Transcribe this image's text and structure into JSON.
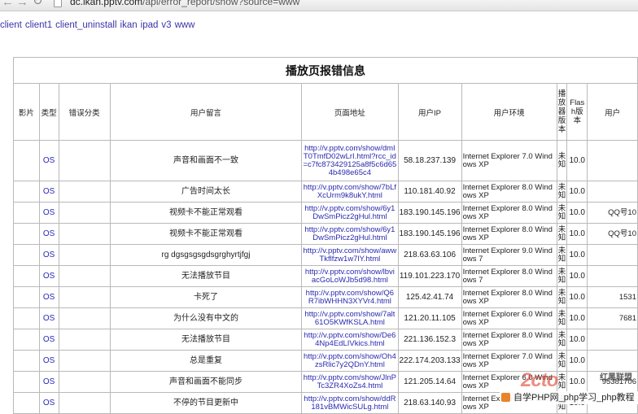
{
  "browser": {
    "url_host": "dc.ikan.pptv.com",
    "url_path": "/api/error_report/show?source=www"
  },
  "links": [
    "client",
    "client1",
    "client_uninstall",
    "ikan",
    "ipad",
    "v3",
    "www"
  ],
  "report": {
    "title": "播放页报错信息",
    "columns": [
      "影片",
      "类型",
      "错误分类",
      "用户留言",
      "页面地址",
      "用户IP",
      "用户环境",
      "播放器版本",
      "Flash版本",
      "用户"
    ],
    "rows": [
      {
        "type": "OS",
        "message": "声音和画面不一致",
        "url": "http://v.pptv.com/show/dmIT0TmfD02wLrI.html?rcc_id=c7fc873429125a8f5c6d654b498e65c4",
        "ip": "58.18.237.139",
        "env": "Internet Explorer 7.0 Windows XP",
        "player": "未知",
        "flash": "10.0",
        "extra": ""
      },
      {
        "type": "OS",
        "message": "广告时间太长",
        "url": "http://v.pptv.com/show/7bLfXcUrm9k8ukY.html",
        "ip": "110.181.40.92",
        "env": "Internet Explorer 8.0 Windows XP",
        "player": "未知",
        "flash": "10.0",
        "extra": ""
      },
      {
        "type": "OS",
        "message": "视频卡不能正常观看",
        "url": "http://v.pptv.com/show/6y1DwSmPicz2gHul.html",
        "ip": "183.190.145.196",
        "env": "Internet Explorer 8.0 Windows XP",
        "player": "未知",
        "flash": "10.0",
        "extra": "QQ号10"
      },
      {
        "type": "OS",
        "message": "视频卡不能正常观看",
        "url": "http://v.pptv.com/show/6y1DwSmPicz2gHul.html",
        "ip": "183.190.145.196",
        "env": "Internet Explorer 8.0 Windows XP",
        "player": "未知",
        "flash": "10.0",
        "extra": "QQ号10"
      },
      {
        "type": "OS",
        "message": "rg dgsgsgsgdsgrghyrtjfgj",
        "url": "http://v.pptv.com/show/awwTkflfzw1w7lY.html",
        "ip": "218.63.63.106",
        "env": "Internet Explorer 9.0 Windows 7",
        "player": "未知",
        "flash": "10.0",
        "extra": ""
      },
      {
        "type": "OS",
        "message": "无法播放节目",
        "url": "http://v.pptv.com/show/lbviacGoLoWJb5d98.html",
        "ip": "119.101.223.170",
        "env": "Internet Explorer 8.0 Windows 7",
        "player": "未知",
        "flash": "10.0",
        "extra": ""
      },
      {
        "type": "OS",
        "message": "卡死了",
        "url": "http://v.pptv.com/show/Q6R7ibWHHN3XYVr4.html",
        "ip": "125.42.41.74",
        "env": "Internet Explorer 8.0 Windows XP",
        "player": "未知",
        "flash": "10.0",
        "extra": "1531"
      },
      {
        "type": "OS",
        "message": "为什么没有中文的",
        "url": "http://v.pptv.com/show/7alt61O5KWfKSLA.html",
        "ip": "121.20.11.105",
        "env": "Internet Explorer 6.0 Windows XP",
        "player": "未知",
        "flash": "10.0",
        "extra": "7681"
      },
      {
        "type": "OS",
        "message": "无法播放节目",
        "url": "http://v.pptv.com/show/De64Np4EdLIVkics.html",
        "ip": "221.136.152.3",
        "env": "Internet Explorer 8.0 Windows XP",
        "player": "未知",
        "flash": "10.0",
        "extra": ""
      },
      {
        "type": "OS",
        "message": "总是重复",
        "url": "http://v.pptv.com/show/Oh4zsRlic7y2QDnY.html",
        "ip": "222.174.203.133",
        "env": "Internet Explorer 7.0 Windows XP",
        "player": "未知",
        "flash": "10.0",
        "extra": ""
      },
      {
        "type": "OS",
        "message": "声音和画面不能同步",
        "url": "http://v.pptv.com/show/JlnPTc3ZR4XoZs4.html",
        "ip": "121.205.14.64",
        "env": "Internet Explorer 6.0 Windows XP",
        "player": "未知",
        "flash": "10.0",
        "extra": "95381706"
      },
      {
        "type": "OS",
        "message": "不停的节目更新中",
        "url": "http://v.pptv.com/show/ddR181vBMWicSULg.html",
        "ip": "218.63.140.93",
        "env": "Internet Explorer 8.0 Windows XP",
        "player": "未知",
        "flash": "10.0",
        "extra": ""
      }
    ]
  },
  "watermark": {
    "logo": "2cto",
    "brand": "红黑联盟",
    "caption": "自学PHP网_php学习_php教程"
  }
}
